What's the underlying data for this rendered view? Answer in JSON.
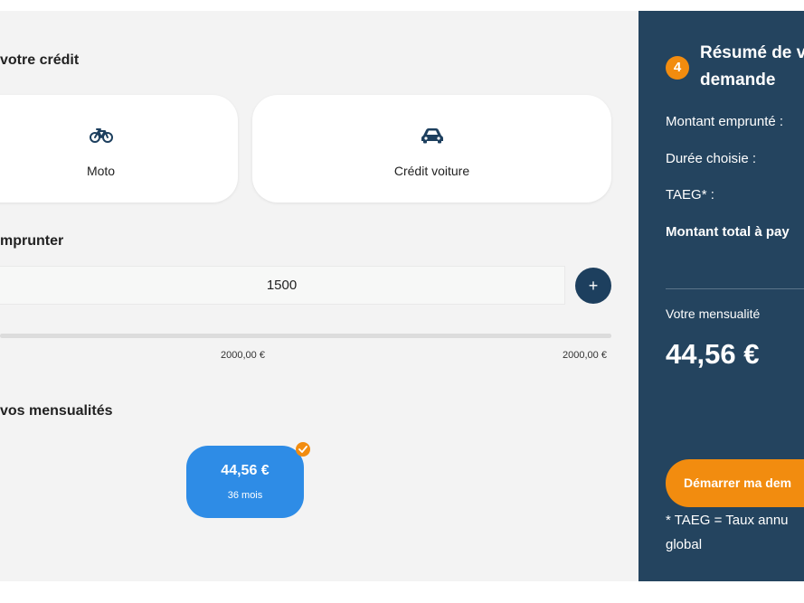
{
  "form": {
    "credit_section_title": "votre crédit",
    "cards": [
      {
        "label": "Moto",
        "icon": "bicycle-icon"
      },
      {
        "label": "Crédit voiture",
        "icon": "car-icon"
      }
    ],
    "amount_section_title": "mprunter",
    "amount_value": "1500",
    "plus_label": "+",
    "slider_fill_fraction": 1.0,
    "slider_ticks": [
      "2000,00 €",
      "2000,00 €"
    ],
    "monthly_section_title": "vos mensualités",
    "monthly_option": {
      "amount": "44,56 €",
      "months": "36 mois",
      "selected": true
    }
  },
  "summary": {
    "step_number": "4",
    "title_line1": "Résumé de v",
    "title_line2": "demande",
    "rows": [
      "Montant emprunté :",
      "Durée choisie :",
      "TAEG* :",
      "Montant total à pay"
    ],
    "monthly_label": "Votre mensualité",
    "monthly_value": "44,56 €",
    "start_button": "Démarrer ma dem",
    "taeg_note_line1": "* TAEG = Taux annu",
    "taeg_note_line2": "global"
  },
  "colors": {
    "panel_bg": "#f3f3f3",
    "summary_bg": "#24445f",
    "accent_orange": "#f28c0f",
    "selected_blue": "#2e8ce6",
    "icon_navy": "#1d3f5e"
  }
}
